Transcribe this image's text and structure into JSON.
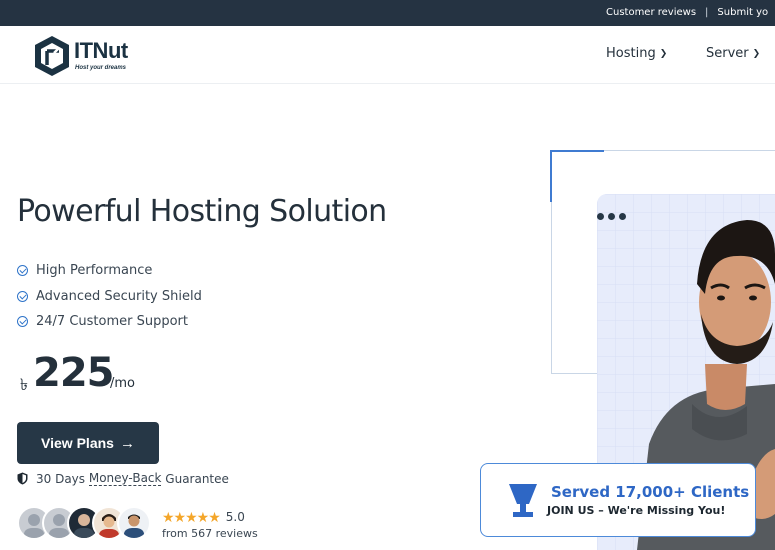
{
  "topbar": {
    "links": [
      "Customer reviews",
      "Submit yo"
    ],
    "separator": "|"
  },
  "logo": {
    "brand": "ITNut",
    "tagline": "Host your dreams"
  },
  "nav": {
    "items": [
      {
        "label": "Hosting",
        "icon": "chevron-down-icon"
      },
      {
        "label": "Server",
        "icon": "chevron-down-icon"
      }
    ]
  },
  "hero": {
    "title": "Powerful Hosting Solution",
    "features": [
      "High Performance",
      "Advanced Security Shield",
      "24/7 Customer Support"
    ],
    "price": {
      "currency": "৳",
      "amount": "225",
      "period": "/mo"
    },
    "cta_label": "View Plans",
    "cta_arrow": "→",
    "guarantee": {
      "prefix": "30 Days ",
      "highlight": "Money-Back",
      "suffix": " Guarantee"
    },
    "rating": {
      "stars": "★★★★★",
      "score": "5.0",
      "reviews_text": "from 567 reviews"
    }
  },
  "badge": {
    "title": "Served 17,000+ Clients",
    "subtitle": "JOIN US – We're Missing You!"
  },
  "colors": {
    "topbar_bg": "#253342",
    "primary_dark": "#263746",
    "accent_blue": "#2e67c5",
    "star_color": "#f4a62a"
  }
}
